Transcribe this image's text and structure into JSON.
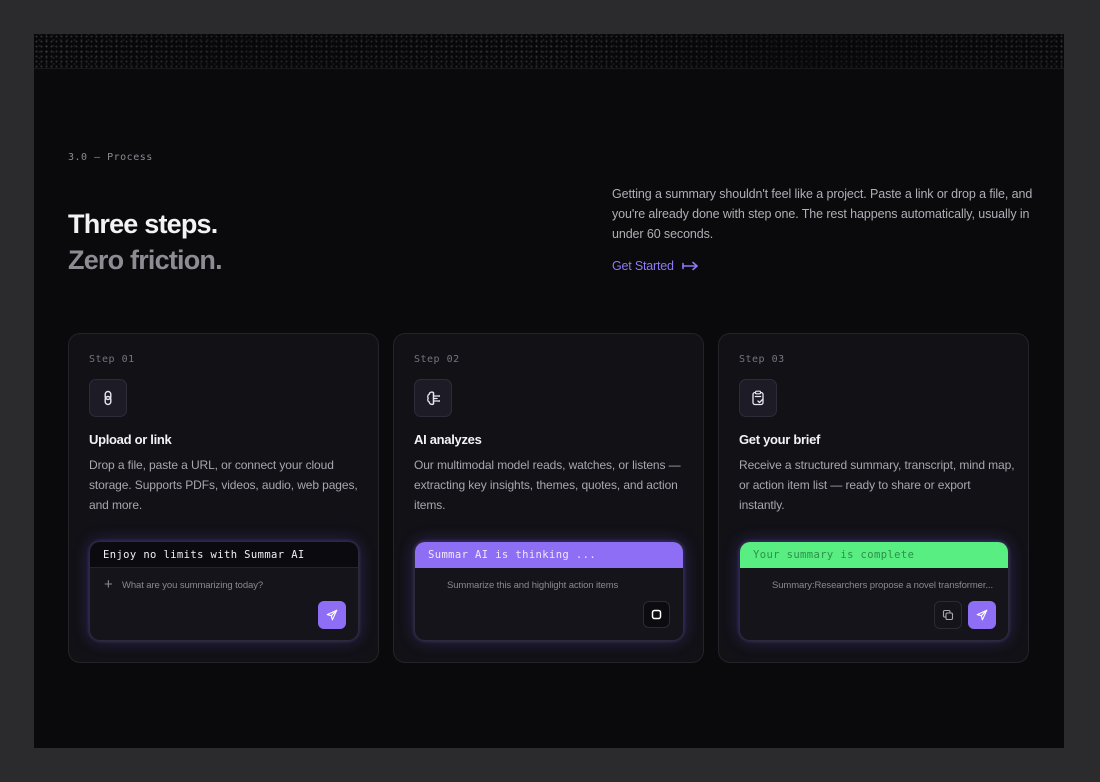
{
  "section_label": "3.0 — Process",
  "headline": {
    "line1": "Three steps.",
    "line2": "Zero friction."
  },
  "intro": "Getting a summary shouldn't feel like a project. Paste a link or drop a file, and you're already done with step one. The rest happens automatically, usually in under 60 seconds.",
  "cta": {
    "label": "Get Started",
    "icon": "arrow-right-icon"
  },
  "steps": [
    {
      "step": "Step 01",
      "icon": "link-icon",
      "title": "Upload or link",
      "description": "Drop a file, paste a URL, or connect your cloud storage. Supports PDFs, videos, audio, web pages, and more.",
      "widget": {
        "bar_text": "Enjoy no limits with Summar AI",
        "bar_color": "#0b0a0e",
        "placeholder": "What are you summarizing today?",
        "action": "send-icon"
      }
    },
    {
      "step": "Step 02",
      "icon": "brain-icon",
      "title": "AI analyzes",
      "description": "Our multimodal model reads, watches, or listens — extracting key insights, themes, quotes, and action items.",
      "widget": {
        "bar_text": "Summar AI is thinking ...",
        "bar_color": "#8e6ef5",
        "input_text": "Summarize this and highlight action items",
        "action": "stop-icon"
      }
    },
    {
      "step": "Step 03",
      "icon": "clipboard-check-icon",
      "title": "Get your brief",
      "description": "Receive a structured summary, transcript, mind map, or action item list — ready to share or export instantly.",
      "widget": {
        "bar_text": "Your summary is complete",
        "bar_color": "#58ee82",
        "input_text": "Summary:Researchers propose a novel transformer...",
        "actions": [
          "copy-icon",
          "send-icon"
        ]
      }
    }
  ],
  "colors": {
    "accent": "#8e6ef5",
    "success": "#58ee82",
    "background": "#0a090c"
  }
}
